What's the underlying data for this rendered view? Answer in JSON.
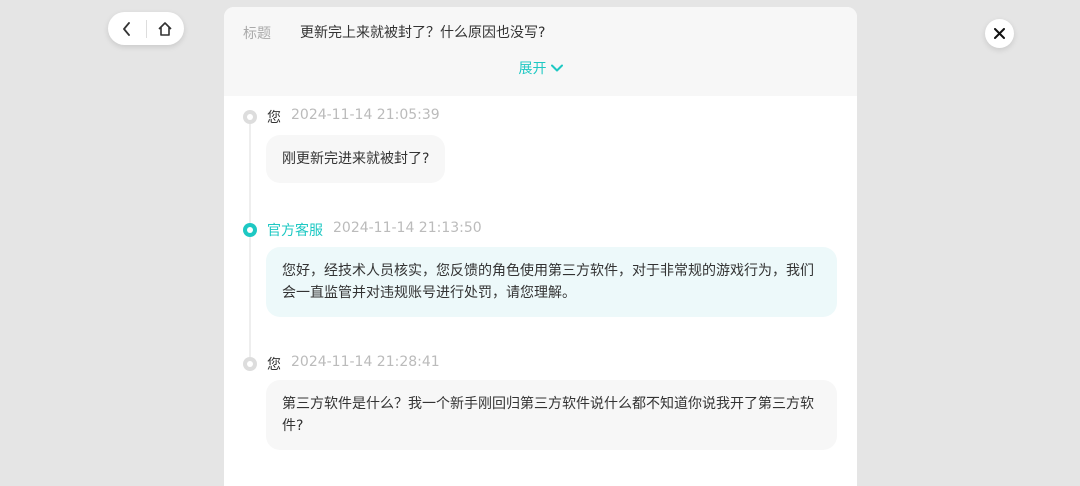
{
  "nav": {
    "back_icon": "chevron-left-icon",
    "home_icon": "home-icon"
  },
  "close_icon": "close-icon",
  "header": {
    "title_label": "标题",
    "title_text": "更新完上来就被封了？什么原因也没写?",
    "expand_label": "展开"
  },
  "messages": [
    {
      "author": "您",
      "time": "2024-11-14 21:05:39",
      "text": "刚更新完进来就被封了?",
      "official": false
    },
    {
      "author": "官方客服",
      "time": "2024-11-14 21:13:50",
      "text": "您好，经技术人员核实，您反馈的角色使用第三方软件，对于非常规的游戏行为，我们会一直监管并对违规账号进行处罚，请您理解。",
      "official": true
    },
    {
      "author": "您",
      "time": "2024-11-14 21:28:41",
      "text": "第三方软件是什么？我一个新手刚回归第三方软件说什么都不知道你说我开了第三方软件?",
      "official": false
    }
  ],
  "colors": {
    "accent": "#1ec8c3",
    "official_bubble": "#edf9fa",
    "user_bubble": "#f7f7f7"
  }
}
